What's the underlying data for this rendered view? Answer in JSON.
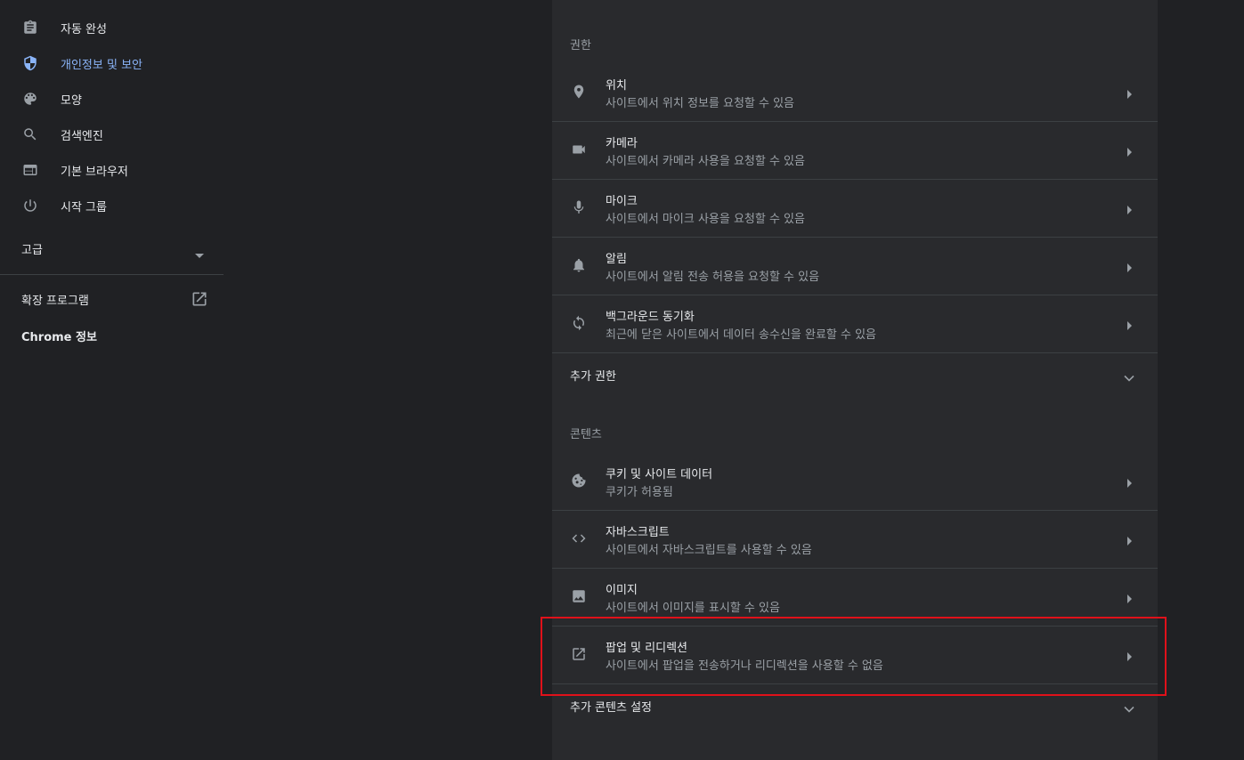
{
  "sidebar": {
    "items": [
      {
        "label": "자동 완성",
        "icon": "autofill-clipboard-icon"
      },
      {
        "label": "개인정보 및 보안",
        "icon": "shield-icon"
      },
      {
        "label": "모양",
        "icon": "palette-icon"
      },
      {
        "label": "검색엔진",
        "icon": "search-icon"
      },
      {
        "label": "기본 브라우저",
        "icon": "browser-window-icon"
      },
      {
        "label": "시작 그룹",
        "icon": "power-icon"
      }
    ],
    "advanced_label": "고급",
    "extensions_label": "확장 프로그램",
    "about_label": "Chrome 정보"
  },
  "main": {
    "permissions_title": "권한",
    "permissions": [
      {
        "title": "위치",
        "subtitle": "사이트에서 위치 정보를 요청할 수 있음",
        "icon": "location-pin-icon"
      },
      {
        "title": "카메라",
        "subtitle": "사이트에서 카메라 사용을 요청할 수 있음",
        "icon": "camera-icon"
      },
      {
        "title": "마이크",
        "subtitle": "사이트에서 마이크 사용을 요청할 수 있음",
        "icon": "microphone-icon"
      },
      {
        "title": "알림",
        "subtitle": "사이트에서 알림 전송 허용을 요청할 수 있음",
        "icon": "bell-icon"
      },
      {
        "title": "백그라운드 동기화",
        "subtitle": "최근에 닫은 사이트에서 데이터 송수신을 완료할 수 있음",
        "icon": "sync-icon"
      }
    ],
    "more_permissions_label": "추가 권한",
    "content_title": "콘텐츠",
    "content": [
      {
        "title": "쿠키 및 사이트 데이터",
        "subtitle": "쿠키가 허용됨",
        "icon": "cookie-icon"
      },
      {
        "title": "자바스크립트",
        "subtitle": "사이트에서 자바스크립트를 사용할 수 있음",
        "icon": "code-brackets-icon"
      },
      {
        "title": "이미지",
        "subtitle": "사이트에서 이미지를 표시할 수 있음",
        "icon": "image-icon"
      },
      {
        "title": "팝업 및 리디렉션",
        "subtitle": "사이트에서 팝업을 전송하거나 리디렉션을 사용할 수 없음",
        "icon": "open-in-new-icon"
      }
    ],
    "more_content_label": "추가 콘텐츠 설정"
  },
  "colors": {
    "background": "#202124",
    "card": "#292a2d",
    "accent": "#8ab4f8",
    "highlight_box": "#e0111a"
  }
}
